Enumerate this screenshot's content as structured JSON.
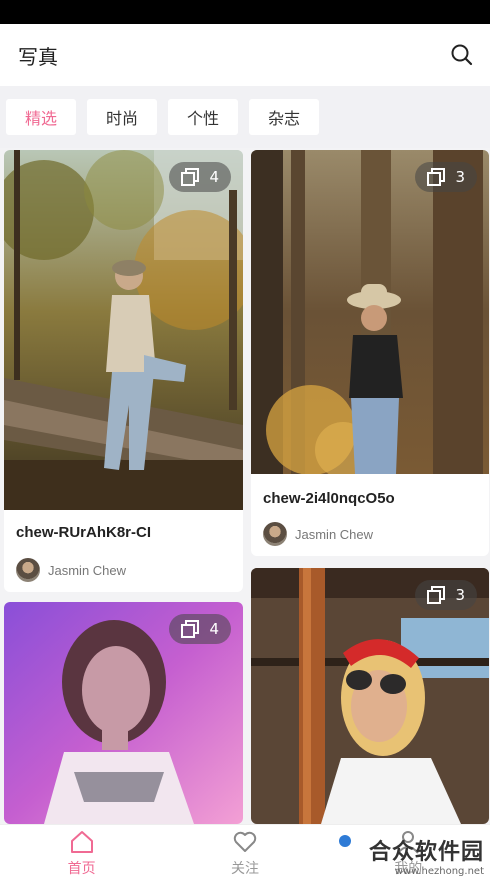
{
  "header": {
    "title": "写真"
  },
  "tabs": [
    {
      "label": "精选",
      "active": true
    },
    {
      "label": "时尚",
      "active": false
    },
    {
      "label": "个性",
      "active": false
    },
    {
      "label": "杂志",
      "active": false
    }
  ],
  "cards": [
    {
      "count": "4",
      "title": "chew-RUrAhK8r-CI",
      "author": "Jasmin Chew"
    },
    {
      "count": "3",
      "title": "chew-2i4l0nqcO5o",
      "author": "Jasmin Chew"
    },
    {
      "count": "4"
    },
    {
      "count": "3"
    }
  ],
  "bottom_nav": [
    {
      "label": "首页",
      "icon": "home-icon",
      "active": true
    },
    {
      "label": "关注",
      "icon": "heart-icon",
      "active": false
    },
    {
      "label": "我的",
      "icon": "user-icon",
      "active": false
    }
  ],
  "watermark": {
    "text": "合众软件园",
    "sub": "www.hezhong.net"
  },
  "colors": {
    "accent": "#f06a93"
  }
}
